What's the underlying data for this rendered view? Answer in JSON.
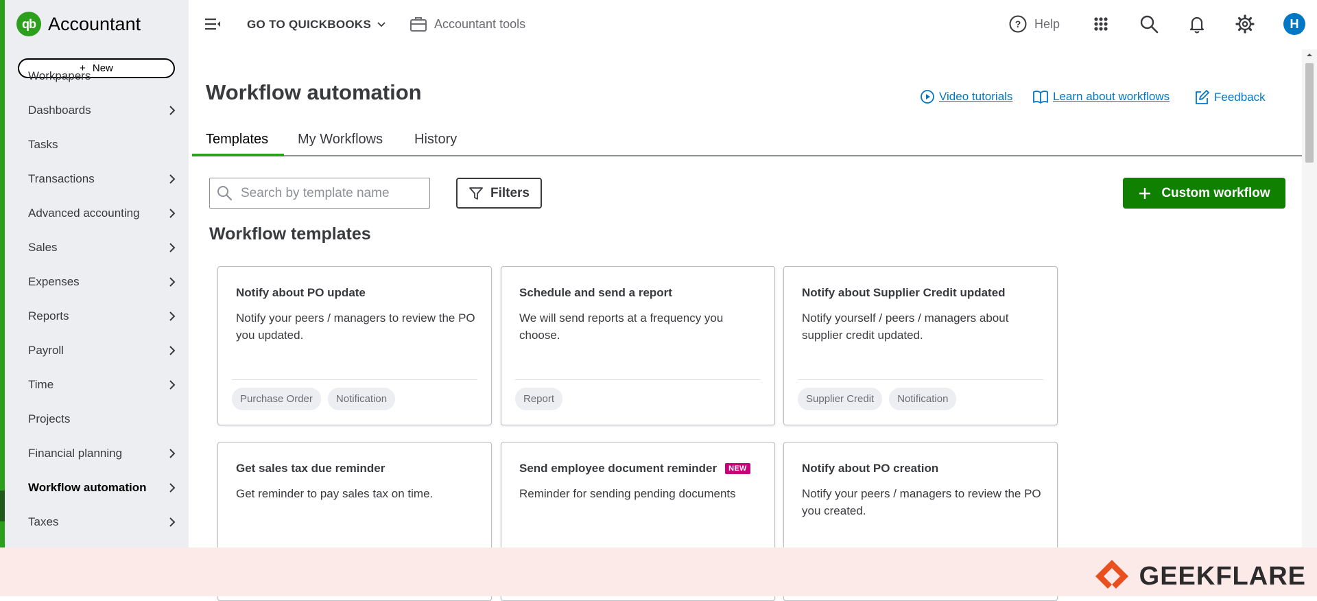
{
  "brand": {
    "logo": "qb",
    "name": "Accountant"
  },
  "sidebar": {
    "new_label": "New",
    "items": [
      {
        "label": "Workpapers",
        "chevron": false,
        "active": false
      },
      {
        "label": "Dashboards",
        "chevron": true,
        "active": false
      },
      {
        "label": "Tasks",
        "chevron": false,
        "active": false
      },
      {
        "label": "Transactions",
        "chevron": true,
        "active": false
      },
      {
        "label": "Advanced accounting",
        "chevron": true,
        "active": false
      },
      {
        "label": "Sales",
        "chevron": true,
        "active": false
      },
      {
        "label": "Expenses",
        "chevron": true,
        "active": false
      },
      {
        "label": "Reports",
        "chevron": true,
        "active": false
      },
      {
        "label": "Payroll",
        "chevron": true,
        "active": false
      },
      {
        "label": "Time",
        "chevron": true,
        "active": false
      },
      {
        "label": "Projects",
        "chevron": false,
        "active": false
      },
      {
        "label": "Financial planning",
        "chevron": true,
        "active": false
      },
      {
        "label": "Workflow automation",
        "chevron": true,
        "active": true
      },
      {
        "label": "Taxes",
        "chevron": true,
        "active": false
      }
    ]
  },
  "topbar": {
    "goto_label": "GO TO QUICKBOOKS",
    "accountant_tools_label": "Accountant tools",
    "help_label": "Help",
    "avatar_initial": "H",
    "icons": [
      "menu-toggle-icon",
      "briefcase-icon",
      "help-circle-icon",
      "apps-grid-icon",
      "search-icon",
      "bell-icon",
      "gear-icon"
    ]
  },
  "page": {
    "title": "Workflow automation",
    "links": {
      "video_tutorials": "Video tutorials",
      "learn_workflows": "Learn about workflows",
      "feedback": "Feedback"
    },
    "tabs": [
      {
        "label": "Templates",
        "active": true
      },
      {
        "label": "My Workflows",
        "active": false
      },
      {
        "label": "History",
        "active": false
      }
    ],
    "search_placeholder": "Search by template name",
    "filters_label": "Filters",
    "custom_workflow_label": "Custom workflow",
    "section_title": "Workflow templates",
    "cards": [
      {
        "title": "Notify about PO update",
        "badge": "",
        "desc": "Notify your peers / managers to review the PO you updated.",
        "tags": [
          "Purchase Order",
          "Notification"
        ]
      },
      {
        "title": "Schedule and send a report",
        "badge": "",
        "desc": "We will send reports at a frequency you choose.",
        "tags": [
          "Report"
        ]
      },
      {
        "title": "Notify about Supplier Credit updated",
        "badge": "",
        "desc": "Notify yourself / peers / managers about supplier credit updated.",
        "tags": [
          "Supplier Credit",
          "Notification"
        ]
      },
      {
        "title": "Get sales tax due reminder",
        "badge": "",
        "desc": "Get reminder to pay sales tax on time.",
        "tags": []
      },
      {
        "title": "Send employee document reminder",
        "badge": "NEW",
        "desc": "Reminder for sending pending documents",
        "tags": []
      },
      {
        "title": "Notify about PO creation",
        "badge": "",
        "desc": "Notify your peers / managers to review the PO you created.",
        "tags": []
      }
    ]
  },
  "footer": {
    "watermark": "GEEKFLARE"
  },
  "colors": {
    "accent_green": "#2ca01c",
    "button_green": "#108000",
    "link_blue": "#0077c5",
    "badge_magenta": "#c9007a"
  }
}
